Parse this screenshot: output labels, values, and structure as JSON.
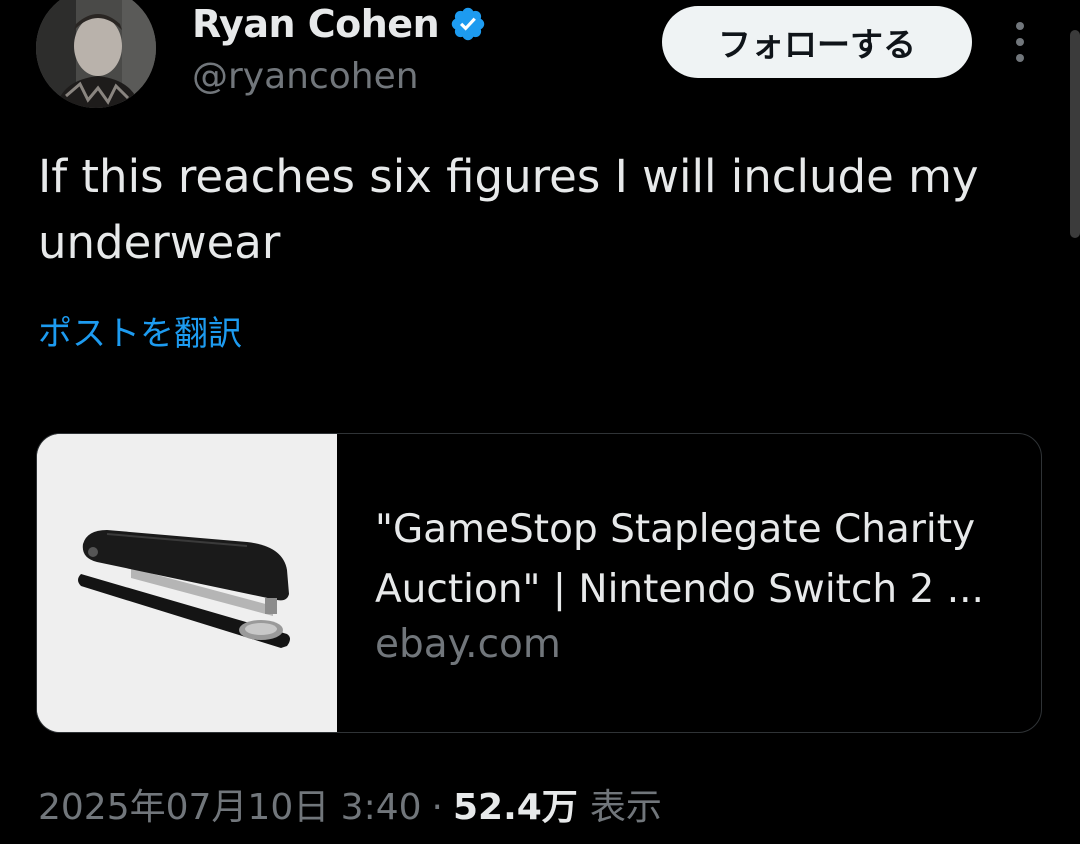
{
  "author": {
    "display_name": "Ryan Cohen",
    "handle": "@ryancohen",
    "verified": true,
    "verified_color": "#1d9bf0"
  },
  "follow_button": {
    "label": "フォローする"
  },
  "more_icon": "more-vertical-icon",
  "tweet": {
    "text": "If this reaches six figures I will include my underwear",
    "translate_label": "ポストを翻訳"
  },
  "link_card": {
    "title": "\"GameStop Staplegate Charity\nAuction\" | Nintendo Switch 2 ...",
    "domain": "ebay.com",
    "thumbnail": "stapler-image"
  },
  "meta": {
    "timestamp": "2025年07月10日 3:40",
    "separator": "·",
    "views_count": "52.4万",
    "views_label": "表示"
  },
  "colors": {
    "background": "#000000",
    "text_primary": "#e7e9ea",
    "text_secondary": "#71767b",
    "link": "#1d9bf0",
    "follow_bg": "#eff3f4"
  }
}
